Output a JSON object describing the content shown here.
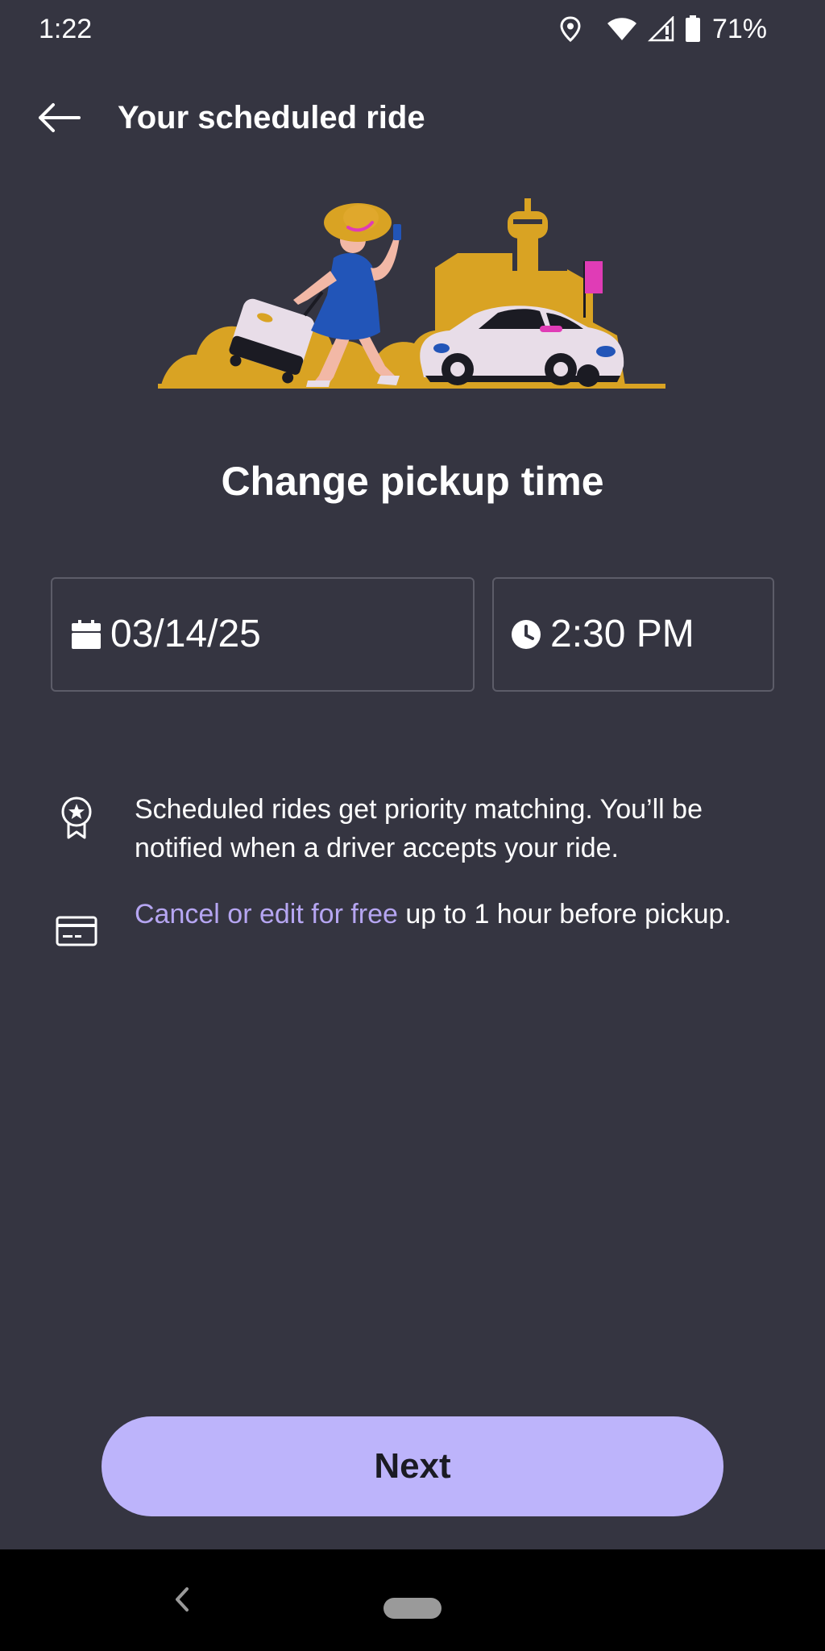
{
  "status_bar": {
    "time": "1:22",
    "battery_percent": "71%",
    "icons": [
      "location-icon",
      "wifi-icon",
      "cell-signal-icon",
      "battery-icon"
    ]
  },
  "header": {
    "back_icon": "back-arrow-icon",
    "title": "Your scheduled ride"
  },
  "main": {
    "title": "Change pickup time",
    "date_field": {
      "icon": "calendar-icon",
      "value": "03/14/25"
    },
    "time_field": {
      "icon": "clock-icon",
      "value": "2:30 PM"
    }
  },
  "info": {
    "priority": {
      "icon": "award-ribbon-icon",
      "text": "Scheduled rides get priority matching. You’ll be notified when a driver accepts your ride."
    },
    "cancel": {
      "icon": "credit-card-icon",
      "link_text": "Cancel or edit for free",
      "text": " up to 1 hour before pickup."
    }
  },
  "next_button": {
    "label": "Next"
  },
  "colors": {
    "background": "#353541",
    "accent": "#bdb4fb",
    "link": "#b6a6f2",
    "illustration_yellow": "#d9a323",
    "illustration_blue": "#2255b8",
    "illustration_pink": "#e03cb6"
  }
}
